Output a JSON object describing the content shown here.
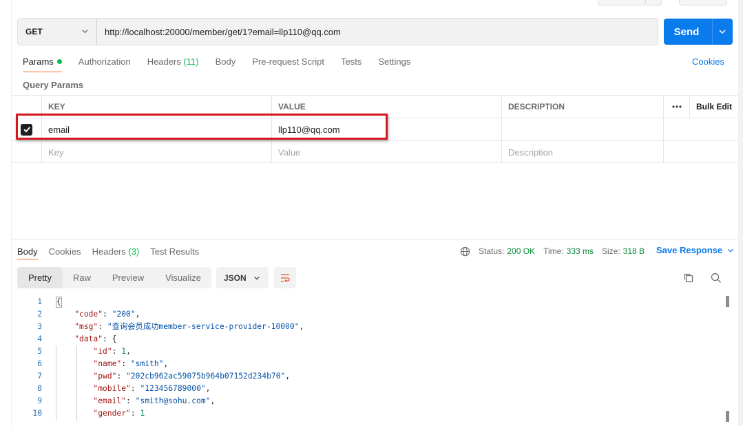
{
  "request": {
    "method": "GET",
    "url": "http://localhost:20000/member/get/1?email=llp110@qq.com",
    "send_label": "Send"
  },
  "request_tabs": [
    {
      "label": "Params",
      "suffix": "",
      "active": true,
      "has_dot": true
    },
    {
      "label": "Authorization",
      "suffix": ""
    },
    {
      "label": "Headers",
      "suffix": "(11)"
    },
    {
      "label": "Body",
      "suffix": ""
    },
    {
      "label": "Pre-request Script",
      "suffix": ""
    },
    {
      "label": "Tests",
      "suffix": ""
    },
    {
      "label": "Settings",
      "suffix": ""
    }
  ],
  "cookies_link": "Cookies",
  "query_params": {
    "title": "Query Params",
    "headers": {
      "key": "KEY",
      "value": "VALUE",
      "description": "DESCRIPTION",
      "bulk_edit": "Bulk Edit"
    },
    "rows": [
      {
        "checked": true,
        "key": "email",
        "value": "llp110@qq.com",
        "description": ""
      }
    ],
    "placeholders": {
      "key": "Key",
      "value": "Value",
      "description": "Description"
    }
  },
  "response": {
    "tabs": [
      {
        "label": "Body",
        "suffix": "",
        "active": true
      },
      {
        "label": "Cookies",
        "suffix": ""
      },
      {
        "label": "Headers",
        "suffix": "(3)"
      },
      {
        "label": "Test Results",
        "suffix": ""
      }
    ],
    "status_label": "Status:",
    "status": "200 OK",
    "time_label": "Time:",
    "time": "333 ms",
    "size_label": "Size:",
    "size": "318 B",
    "save_label": "Save Response",
    "view_modes": [
      "Pretty",
      "Raw",
      "Preview",
      "Visualize"
    ],
    "active_view": "Pretty",
    "format": "JSON",
    "body_lines": [
      {
        "n": "1",
        "text": "{"
      },
      {
        "n": "2",
        "text": "    \"code\": \"200\","
      },
      {
        "n": "3",
        "text": "    \"msg\": \"查询会员成功member-service-provider-10000\","
      },
      {
        "n": "4",
        "text": "    \"data\": {"
      },
      {
        "n": "5",
        "text": "        \"id\": 1,"
      },
      {
        "n": "6",
        "text": "        \"name\": \"smith\","
      },
      {
        "n": "7",
        "text": "        \"pwd\": \"202cb962ac59075b964b07152d234b70\","
      },
      {
        "n": "8",
        "text": "        \"mobile\": \"123456789000\","
      },
      {
        "n": "9",
        "text": "        \"email\": \"smith@sohu.com\","
      },
      {
        "n": "10",
        "text": "        \"gender\": 1"
      }
    ]
  },
  "colors": {
    "accent": "#097bed",
    "tab_underline": "#ff6c37",
    "status_ok": "#0a8a3c",
    "highlight": "#d4171c"
  }
}
